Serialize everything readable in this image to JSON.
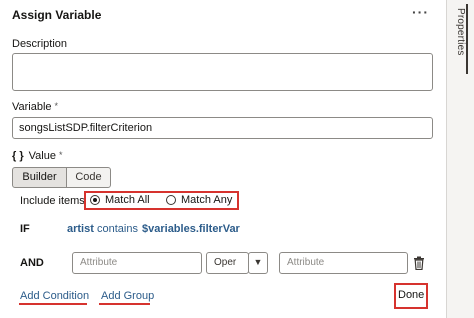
{
  "panel": {
    "title": "Assign Variable",
    "more_icon": "⋮",
    "more_glyph": "···",
    "close_glyph": "×"
  },
  "side_tab": {
    "label": "Properties"
  },
  "description": {
    "label": "Description",
    "value": ""
  },
  "variable": {
    "label": "Variable",
    "required_mark": "*",
    "value": "songsListSDP.filterCriterion"
  },
  "value_section": {
    "braces": "{ }",
    "label": "Value",
    "required_mark": "*"
  },
  "mode_tabs": [
    {
      "label": "Builder",
      "selected": true
    },
    {
      "label": "Code",
      "selected": false
    }
  ],
  "include_items": {
    "label": "Include items",
    "options": [
      {
        "label": "Match All",
        "selected": true
      },
      {
        "label": "Match Any",
        "selected": false
      }
    ]
  },
  "if_row": {
    "keyword": "IF",
    "field": "artist",
    "operator": "contains",
    "value": "$variables.filterVar"
  },
  "and_row": {
    "keyword": "AND",
    "attribute_placeholder": "Attribute",
    "operator_value": "Oper",
    "value_placeholder": "Attribute",
    "chevron_glyph": "▼"
  },
  "footer": {
    "add_condition": "Add Condition",
    "add_group": "Add Group",
    "done": "Done"
  },
  "colors": {
    "highlight": "#d6332e",
    "link": "#2c5c8a",
    "border": "#8c8a86"
  }
}
